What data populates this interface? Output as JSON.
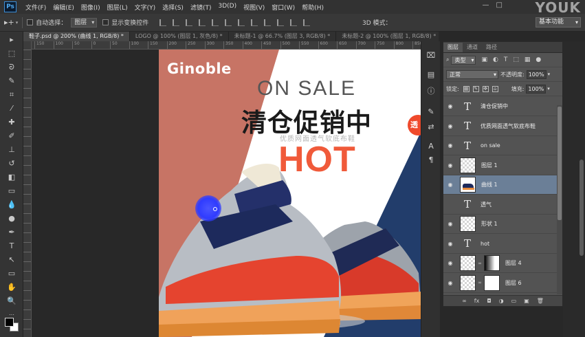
{
  "app": {
    "logo_text": "Ps",
    "watermark": "YOUK",
    "menu": [
      "文件(F)",
      "编辑(E)",
      "图像(I)",
      "图层(L)",
      "文字(Y)",
      "选择(S)",
      "滤镜(T)",
      "3D(D)",
      "视图(V)",
      "窗口(W)",
      "帮助(H)"
    ]
  },
  "options": {
    "auto_select_label": "自动选择：",
    "auto_select_value": "图层",
    "show_transform_label": "显示变换控件",
    "mode_3d_label": "3D 模式：",
    "workspace": "基本功能"
  },
  "tabs": [
    {
      "label": "鞋子.psd @ 200% (曲线 1, RGB/8) *",
      "active": true
    },
    {
      "label": "LOGO @ 100% (图层 1, 灰色/8) *",
      "active": false
    },
    {
      "label": "未标题-1 @ 66.7% (图层 3, RGB/8) *",
      "active": false
    },
    {
      "label": "未标题-2 @ 100% (图层 1, RGB/8) *",
      "active": false
    }
  ],
  "ruler": {
    "top_ticks": [
      "150",
      "100",
      "50",
      "0",
      "50",
      "100",
      "150",
      "200",
      "250",
      "300",
      "350",
      "400",
      "450",
      "500",
      "550",
      "600",
      "650",
      "700",
      "750",
      "800",
      "850"
    ]
  },
  "artwork": {
    "brand": "Ginoble",
    "headline_en": "ON SALE",
    "headline_cn": "清仓促销中",
    "subtitle": "优质网面透气软底布鞋",
    "hot": "HOT",
    "badge": "透",
    "colors": {
      "salmon": "#c77465",
      "navy": "#223d6b",
      "hot_red": "#f05a3a"
    }
  },
  "layers_panel": {
    "tabs": [
      {
        "label": "图层",
        "active": true
      },
      {
        "label": "通道",
        "active": false
      },
      {
        "label": "路径",
        "active": false
      }
    ],
    "filter_value": "类型",
    "blend_mode": "正常",
    "opacity_label": "不透明度:",
    "opacity_value": "100%",
    "lock_label": "锁定:",
    "fill_label": "填充:",
    "fill_value": "100%",
    "layers": [
      {
        "name": "清仓促销中",
        "kind": "text",
        "visible": true,
        "selected": false
      },
      {
        "name": "优质网面透气软底布鞋",
        "kind": "text",
        "visible": true,
        "selected": false
      },
      {
        "name": "on sale",
        "kind": "text",
        "visible": true,
        "selected": false
      },
      {
        "name": "图层 1",
        "kind": "image",
        "visible": true,
        "selected": false
      },
      {
        "name": "曲线 1",
        "kind": "shoe",
        "visible": true,
        "selected": true
      },
      {
        "name": "透气",
        "kind": "text",
        "visible": false,
        "selected": false
      },
      {
        "name": "形状 1",
        "kind": "image",
        "visible": true,
        "selected": false
      },
      {
        "name": "hot",
        "kind": "text",
        "visible": true,
        "selected": false
      },
      {
        "name": "图层 4",
        "kind": "masked",
        "visible": true,
        "selected": false
      },
      {
        "name": "图层 6",
        "kind": "masked-white",
        "visible": true,
        "selected": false
      }
    ],
    "footer_icons": [
      "link-icon",
      "fx-icon",
      "mask-icon",
      "adjustment-icon",
      "folder-icon",
      "new-layer-icon",
      "trash-icon"
    ]
  }
}
